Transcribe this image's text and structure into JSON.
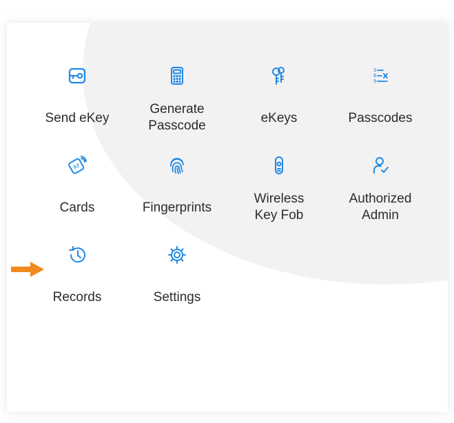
{
  "accent_color": "#1e88e5",
  "arrow_color": "#f08a1c",
  "menu": {
    "items": [
      {
        "label": "Send eKey",
        "icon": "ekey-send-icon"
      },
      {
        "label": "Generate\nPasscode",
        "icon": "calculator-icon"
      },
      {
        "label": "eKeys",
        "icon": "keys-icon"
      },
      {
        "label": "Passcodes",
        "icon": "passcode-list-icon"
      },
      {
        "label": "Cards",
        "icon": "rf-card-icon"
      },
      {
        "label": "Fingerprints",
        "icon": "fingerprint-icon"
      },
      {
        "label": "Wireless\nKey Fob",
        "icon": "key-fob-icon"
      },
      {
        "label": "Authorized\nAdmin",
        "icon": "user-check-icon"
      },
      {
        "label": "Records",
        "icon": "history-icon"
      },
      {
        "label": "Settings",
        "icon": "gear-icon"
      }
    ]
  }
}
